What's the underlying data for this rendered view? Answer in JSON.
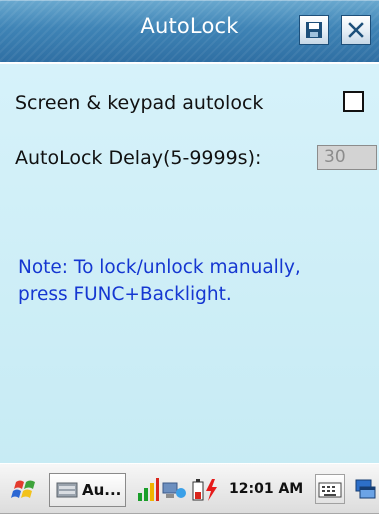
{
  "window": {
    "title": "AutoLock"
  },
  "settings": {
    "autolock_label": "Screen & keypad autolock",
    "autolock_checked": false,
    "delay_label": "AutoLock Delay(5-9999s):",
    "delay_value": "30"
  },
  "note": {
    "line1": "Note: To lock/unlock manually,",
    "line2": "press FUNC+Backlight."
  },
  "taskbar": {
    "task_label": "Au...",
    "clock": "12:01 AM"
  },
  "colors": {
    "title_bar": "#3f84b6",
    "background": "#cfeef6",
    "note_text": "#1537d1"
  }
}
